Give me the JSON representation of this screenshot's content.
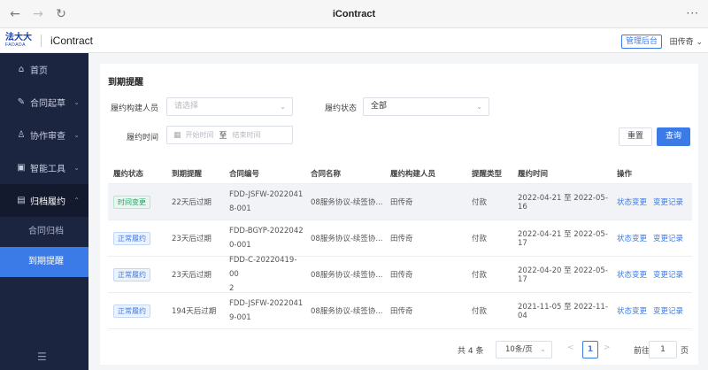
{
  "browser": {
    "title": "iContract",
    "back_glyph": "←",
    "forward_glyph": "→",
    "reload_glyph": "↻",
    "more_glyph": "···"
  },
  "header": {
    "logo_cn": "法大大",
    "logo_en": "FADADA",
    "app_name": "iContract",
    "admin_button": "管理后台",
    "user_name": "田传奇",
    "user_chevron": "⌄"
  },
  "sidebar": {
    "items": [
      {
        "label": "首页",
        "icon": "home-icon",
        "glyph": "⌂"
      },
      {
        "label": "合同起草",
        "icon": "edit-icon",
        "glyph": "✎",
        "chevron": "⌄"
      },
      {
        "label": "协作审查",
        "icon": "user-review-icon",
        "glyph": "♙",
        "chevron": "⌄"
      },
      {
        "label": "智能工具",
        "icon": "tool-icon",
        "glyph": "▣",
        "chevron": "⌄"
      },
      {
        "label": "归档履约",
        "icon": "archive-icon",
        "glyph": "▤",
        "chevron": "⌃"
      }
    ],
    "sub_items": [
      {
        "label": "合同归档"
      },
      {
        "label": "到期提醒"
      }
    ],
    "bottom_glyph": "☰"
  },
  "page": {
    "title": "到期提醒",
    "filters": {
      "creator_label": "履约构建人员",
      "creator_placeholder": "请选择",
      "status_label": "履约状态",
      "status_value": "全部",
      "time_label": "履约时间",
      "start_placeholder": "开始时间",
      "range_sep": "至",
      "end_placeholder": "结束时间",
      "arrow": "⌄",
      "calendar_glyph": "▦"
    },
    "buttons": {
      "reset": "重置",
      "query": "查询"
    }
  },
  "table": {
    "headers": [
      "履约状态",
      "到期提醒",
      "合同编号",
      "合同名称",
      "履约构建人员",
      "提醒类型",
      "履约时间",
      "操作"
    ],
    "rows": [
      {
        "status": "时间变更",
        "status_color": "green",
        "remind": "22天后过期",
        "code_line1": "FDD-JSFW-2022041",
        "code_line2": "8-001",
        "name": "08服务协议-续签协...",
        "creator": "田传奇",
        "type": "付款",
        "time": "2022-04-21 至 2022-05-16",
        "op1": "状态变更",
        "op2": "变更记录"
      },
      {
        "status": "正常履约",
        "status_color": "blue",
        "remind": "23天后过期",
        "code_line1": "FDD-BGYP-2022042",
        "code_line2": "0-001",
        "name": "08服务协议-续签协...",
        "creator": "田传奇",
        "type": "付款",
        "time": "2022-04-21 至 2022-05-17",
        "op1": "状态变更",
        "op2": "变更记录"
      },
      {
        "status": "正常履约",
        "status_color": "blue",
        "remind": "23天后过期",
        "code_line1": "FDD-C-20220419-00",
        "code_line2": "2",
        "name": "08服务协议-续签协...",
        "creator": "田传奇",
        "type": "付款",
        "time": "2022-04-20 至 2022-05-17",
        "op1": "状态变更",
        "op2": "变更记录"
      },
      {
        "status": "正常履约",
        "status_color": "blue",
        "remind": "194天后过期",
        "code_line1": "FDD-JSFW-2022041",
        "code_line2": "9-001",
        "name": "08服务协议-续签协...",
        "creator": "田传奇",
        "type": "付款",
        "time": "2021-11-05 至 2022-11-04",
        "op1": "状态变更",
        "op2": "变更记录"
      }
    ]
  },
  "pagination": {
    "total": "共 4 条",
    "page_size": "10条/页",
    "prev_glyph": "<",
    "current_page": "1",
    "next_glyph": ">",
    "goto_prefix": "前往",
    "goto_value": "1",
    "goto_suffix": "页"
  },
  "colors": {
    "sidebar_bg": "#1c2540",
    "accent": "#3b7be8",
    "tag_green": "#21a366"
  }
}
